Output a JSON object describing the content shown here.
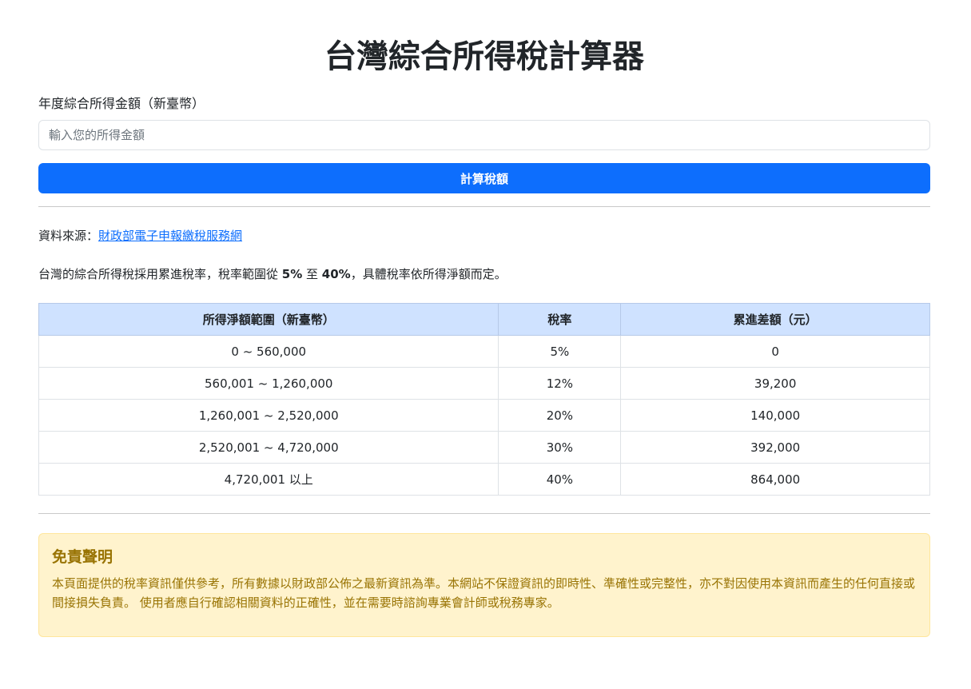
{
  "page": {
    "title": "台灣綜合所得稅計算器"
  },
  "form": {
    "label": "年度綜合所得金額（新臺幣）",
    "input_value": "",
    "input_placeholder": "輸入您的所得金額",
    "button_label": "計算稅額"
  },
  "source": {
    "prefix": "資料來源：",
    "link_text": "財政部電子申報繳稅服務網"
  },
  "description": {
    "part1": "台灣的綜合所得稅採用累進稅率，稅率範圍從 ",
    "min_rate": "5%",
    "part2": " 至 ",
    "max_rate": "40%",
    "part3": "，具體稅率依所得淨額而定。"
  },
  "table": {
    "headers": [
      "所得淨額範圍（新臺幣）",
      "稅率",
      "累進差額（元）"
    ],
    "rows": [
      [
        "0 ~ 560,000",
        "5%",
        "0"
      ],
      [
        "560,001 ~ 1,260,000",
        "12%",
        "39,200"
      ],
      [
        "1,260,001 ~ 2,520,000",
        "20%",
        "140,000"
      ],
      [
        "2,520,001 ~ 4,720,000",
        "30%",
        "392,000"
      ],
      [
        "4,720,001 以上",
        "40%",
        "864,000"
      ]
    ]
  },
  "disclaimer": {
    "title": "免責聲明",
    "body": "本頁面提供的稅率資訊僅供參考，所有數據以財政部公佈之最新資訊為準。本網站不保證資訊的即時性、準確性或完整性，亦不對因使用本資訊而產生的任何直接或間接損失負責。 使用者應自行確認相關資料的正確性，並在需要時諮詢專業會計師或稅務專家。"
  },
  "colors": {
    "primary": "#0d6efd",
    "table_header_bg": "#cfe2ff",
    "warning_bg": "#fff3cd",
    "warning_text": "#997404"
  }
}
